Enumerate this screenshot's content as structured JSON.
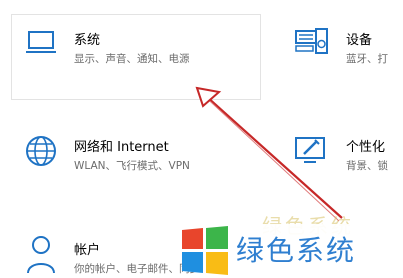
{
  "tiles": [
    {
      "title": "系统",
      "subtitle": "显示、声音、通知、电源"
    },
    {
      "title": "设备",
      "subtitle": "蓝牙、打"
    },
    {
      "title": "网络和 Internet",
      "subtitle": "WLAN、飞行模式、VPN"
    },
    {
      "title": "个性化",
      "subtitle": "背景、锁"
    },
    {
      "title": "帐户",
      "subtitle": "你的帐户、电子邮件、同步"
    }
  ],
  "watermark": {
    "text": "绿色系统",
    "faded_text": "绿色系统",
    "colors": {
      "red": "#e8452c",
      "green": "#3cb54a",
      "blue": "#1f8fe0",
      "yellow": "#f9bc15",
      "text": "#2f7fd0"
    }
  },
  "arrow": {
    "color": "#c62828"
  }
}
